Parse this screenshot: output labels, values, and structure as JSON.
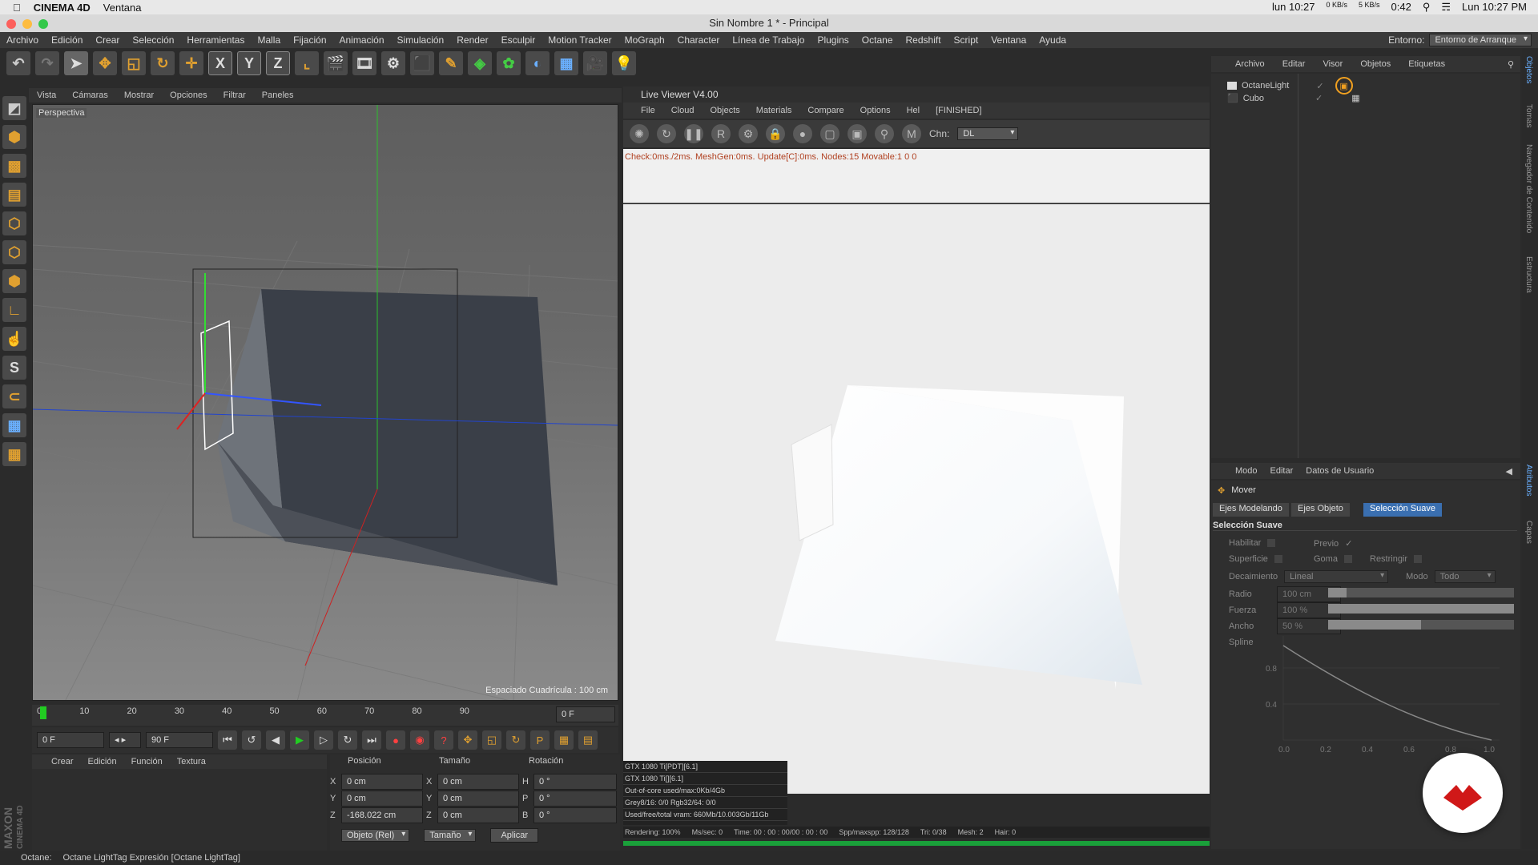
{
  "macbar": {
    "app_name": "CINEMA 4D",
    "menu": "Ventana",
    "clock_left": "lun 10:27",
    "net_up": "0 KB/s",
    "net_down": "5 KB/s",
    "battery_time": "0:42",
    "clock_right": "Lun 10:27 PM"
  },
  "window_title": "Sin Nombre 1 * - Principal",
  "app_menu": [
    "Archivo",
    "Edición",
    "Crear",
    "Selección",
    "Herramientas",
    "Malla",
    "Fijación",
    "Animación",
    "Simulación",
    "Render",
    "Esculpir",
    "Motion Tracker",
    "MoGraph",
    "Character",
    "Línea de Trabajo",
    "Plugins",
    "Octane",
    "Redshift",
    "Script",
    "Ventana",
    "Ayuda"
  ],
  "environment": {
    "label": "Entorno:",
    "value": "Entorno de Arranque"
  },
  "viewport": {
    "menu": [
      "Vista",
      "Cámaras",
      "Mostrar",
      "Opciones",
      "Filtrar",
      "Paneles"
    ],
    "camera_label": "Perspectiva",
    "grid_spacing": "Espaciado Cuadrícula : 100 cm"
  },
  "timeline": {
    "ticks": [
      "0",
      "10",
      "20",
      "30",
      "40",
      "50",
      "60",
      "70",
      "80",
      "90"
    ],
    "current_frame_field": "0 F",
    "start_field": "0 F",
    "end_field": "90 F"
  },
  "materials_menu": [
    "Crear",
    "Edición",
    "Función",
    "Textura"
  ],
  "coords": {
    "headers": {
      "position": "Posición",
      "size": "Tamaño",
      "rotation": "Rotación"
    },
    "rows": [
      {
        "axis": "X",
        "pos": "0 cm",
        "size_axis": "X",
        "size": "0 cm",
        "rot_axis": "H",
        "rot": "0 °"
      },
      {
        "axis": "Y",
        "pos": "0 cm",
        "size_axis": "Y",
        "size": "0 cm",
        "rot_axis": "P",
        "rot": "0 °"
      },
      {
        "axis": "Z",
        "pos": "-168.022 cm",
        "size_axis": "Z",
        "size": "0 cm",
        "rot_axis": "B",
        "rot": "0 °"
      }
    ],
    "mode_dropdown": "Objeto (Rel)",
    "size_dropdown": "Tamaño",
    "apply_button": "Aplicar"
  },
  "live_viewer": {
    "title": "Live Viewer V4.00",
    "menu": [
      "File",
      "Cloud",
      "Objects",
      "Materials",
      "Compare",
      "Options",
      "Hel"
    ],
    "state": "[FINISHED]",
    "channel_label": "Chn:",
    "channel_value": "DL",
    "status_line": "Check:0ms./2ms. MeshGen:0ms. Update[C]:0ms. Nodes:15 Movable:1  0 0",
    "stats": [
      "GTX 1080 Ti[PDT][6.1]",
      "GTX 1080 Ti[][6.1]",
      "Out-of-core used/max:0Kb/4Gb",
      "Grey8/16: 0/0        Rgb32/64: 0/0",
      "Used/free/total vram: 660Mb/10.003Gb/11Gb"
    ],
    "render_bar": {
      "rendering": "Rendering: 100%",
      "ms_sec": "Ms/sec: 0",
      "time": "Time: 00 : 00 : 00/00 : 00 : 00",
      "spp": "Spp/maxspp: 128/128",
      "tri": "Tri: 0/38",
      "mesh": "Mesh: 2",
      "hair": "Hair: 0"
    },
    "progress": 1.0
  },
  "objects_panel": {
    "menu": [
      "Archivo",
      "Editar",
      "Visor",
      "Objetos",
      "Etiquetas"
    ],
    "items": [
      {
        "name": "OctaneLight",
        "color": "#f0a020"
      },
      {
        "name": "Cubo",
        "color": "#c8c8c8"
      }
    ]
  },
  "side_tabs": [
    "Objetos",
    "Tomas",
    "Navegador de Contenido",
    "Estructura",
    "Atributos",
    "Capas"
  ],
  "attributes": {
    "menu": [
      "Modo",
      "Editar",
      "Datos de Usuario"
    ],
    "tool_name": "Mover",
    "tabs": [
      "Ejes Modelando",
      "Ejes Objeto",
      "Selección Suave"
    ],
    "active_tab": "Selección Suave",
    "section": "Selección Suave",
    "checks": [
      {
        "label": "Habilitar"
      },
      {
        "label": "Previo",
        "value": "✓"
      },
      {
        "label": "Superficie"
      },
      {
        "label": "Goma"
      },
      {
        "label": "Restringir"
      }
    ],
    "falloff": {
      "label": "Decaimiento",
      "value": "Lineal",
      "mode_label": "Modo",
      "mode_value": "Todo"
    },
    "radius": {
      "label": "Radio",
      "value": "100 cm",
      "fill": 0.1
    },
    "strength": {
      "label": "Fuerza",
      "value": "100 %",
      "fill": 1.0
    },
    "width": {
      "label": "Ancho",
      "value": "50 %",
      "fill": 0.5
    },
    "spline_label": "Spline",
    "spline_y_ticks": [
      "0.8",
      "0.4"
    ],
    "spline_x_ticks": [
      "0.0",
      "0.2",
      "0.4",
      "0.6",
      "0.8",
      "1.0"
    ]
  },
  "status_bar": {
    "prefix": "Octane:",
    "text": "Octane LightTag Expresión [Octane LightTag]"
  },
  "branding": {
    "maxon": "MAXON",
    "product": "CINEMA 4D"
  }
}
